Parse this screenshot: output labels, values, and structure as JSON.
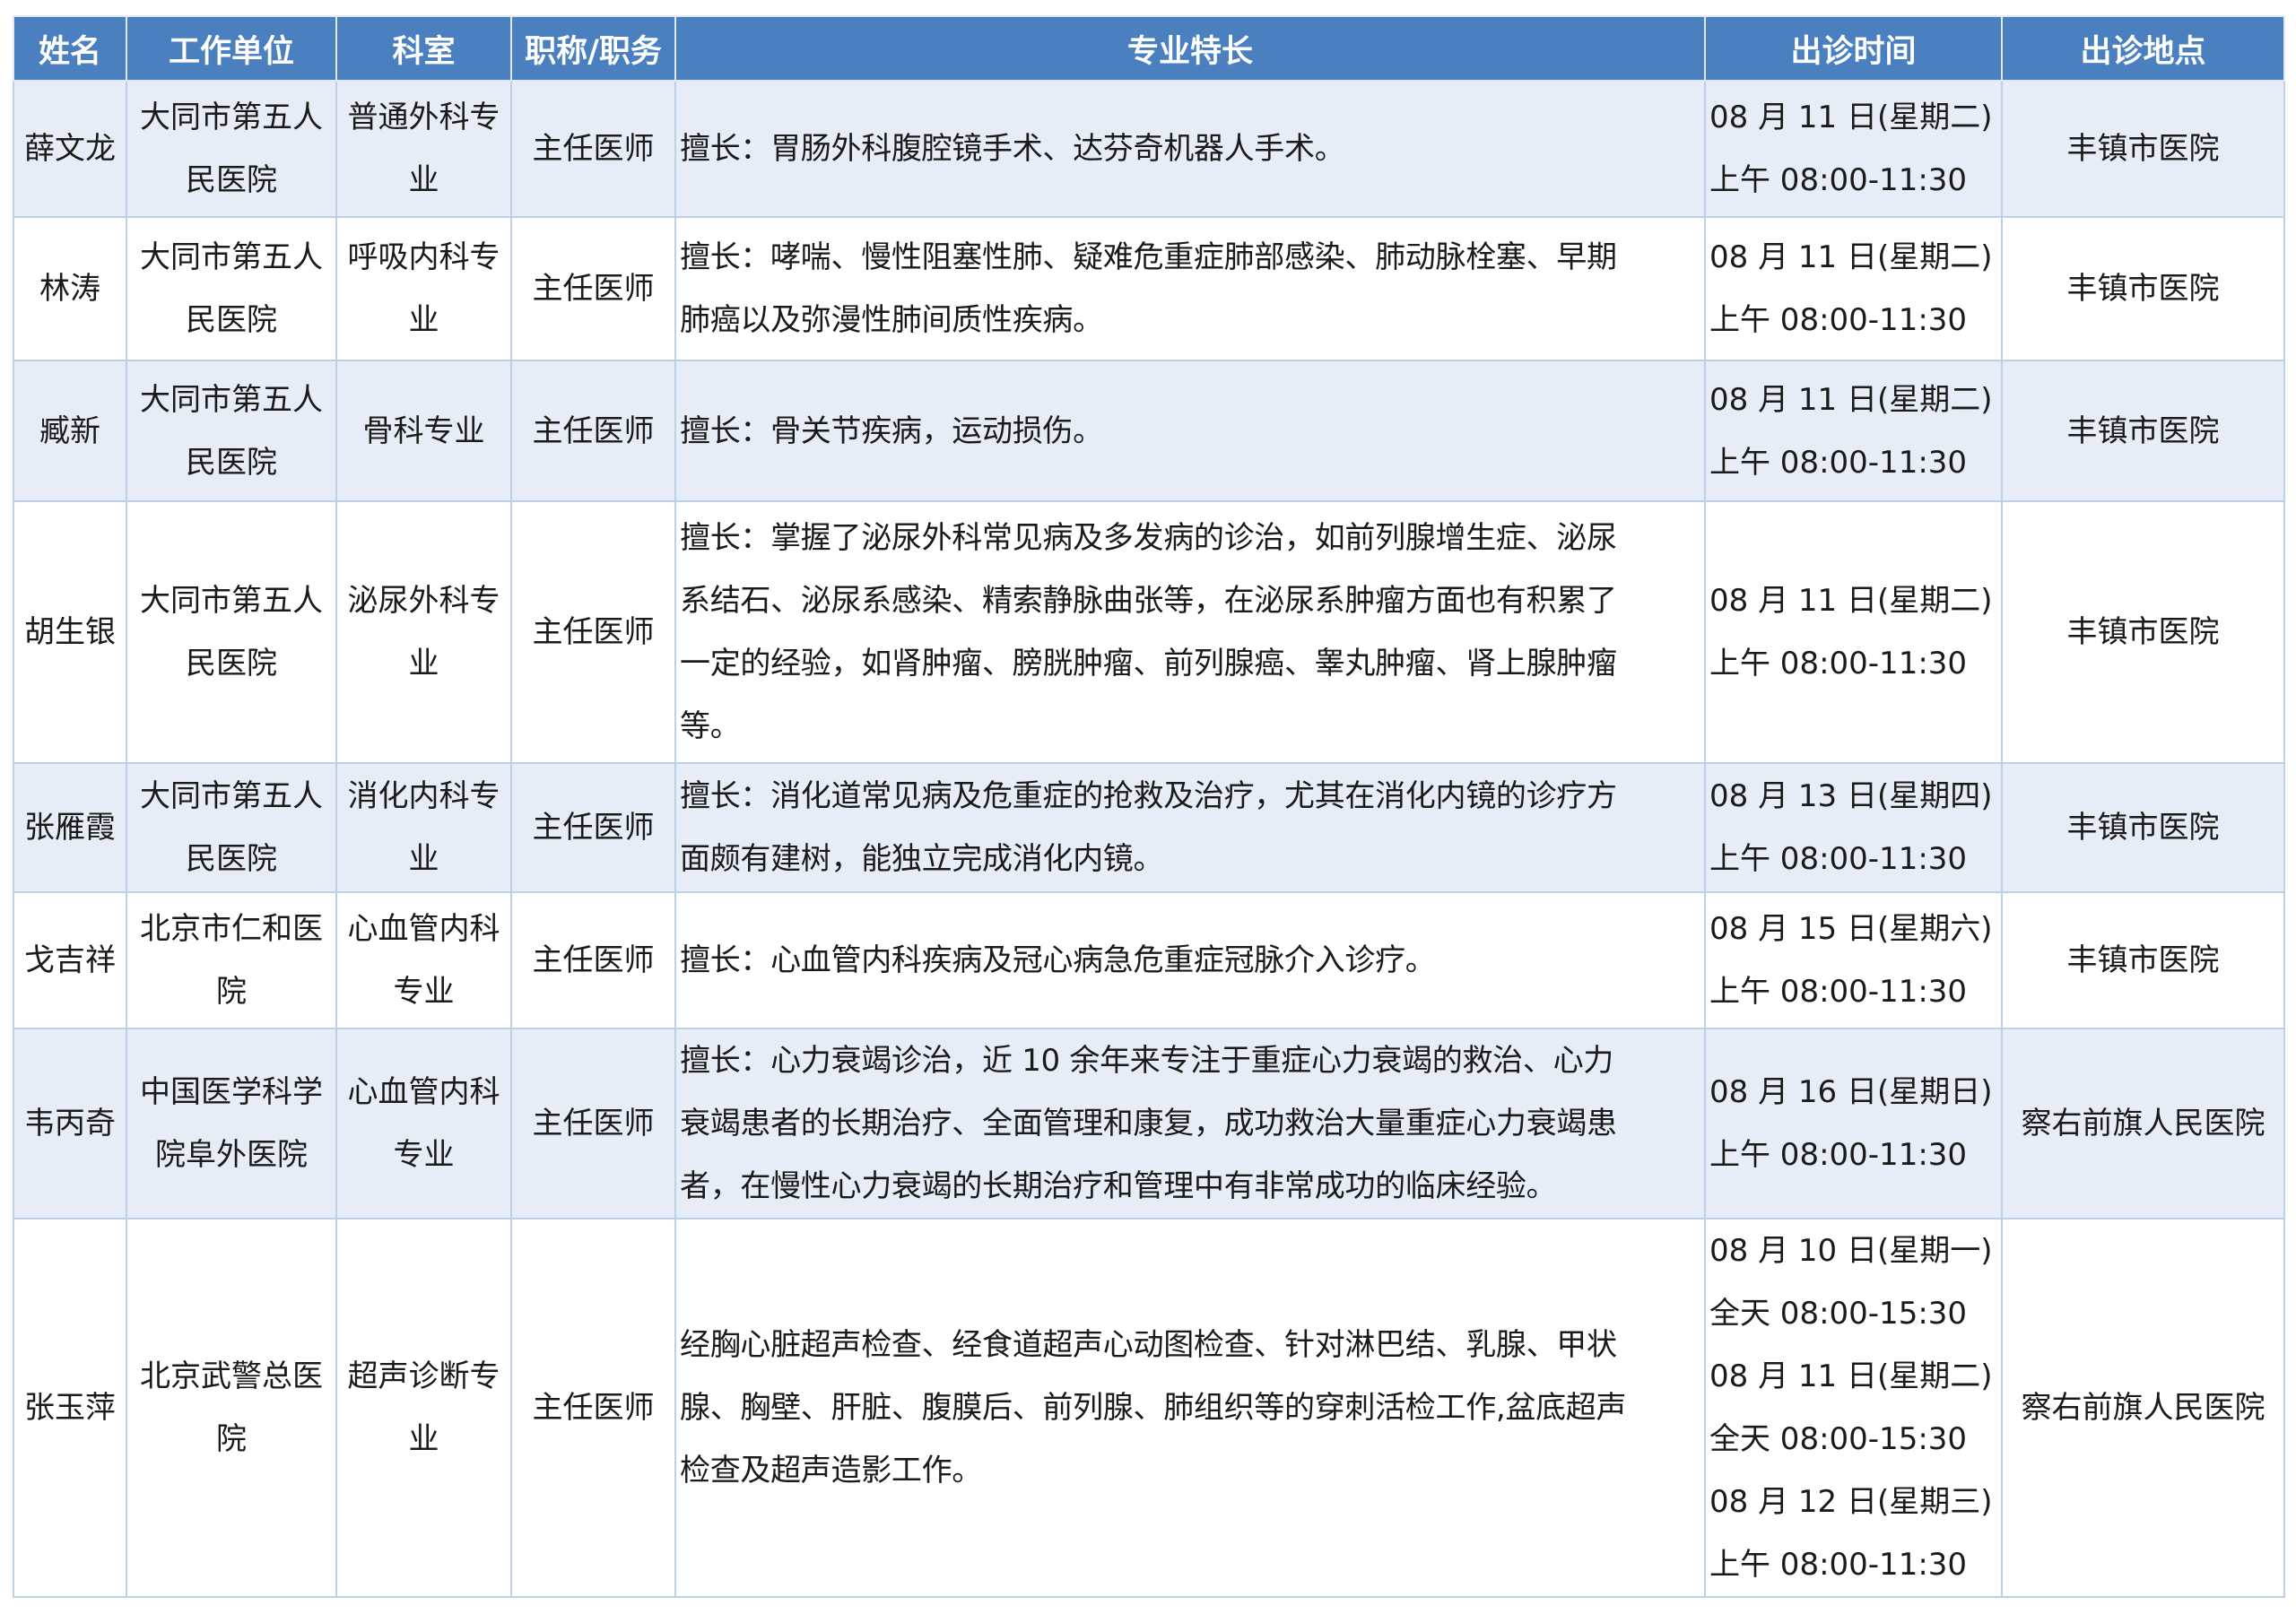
{
  "headers": [
    "姓名",
    "工作单位",
    "科室",
    "职称/职务",
    "专业特长",
    "出诊时间",
    "出诊地点"
  ],
  "rows": [
    {
      "name": "薛文龙",
      "unit": [
        "大同市第五人",
        "民医院"
      ],
      "dept": [
        "普通外科专",
        "业"
      ],
      "title": "主任医师",
      "specialty": [
        "擅长：胃肠外科腹腔镜手术、达芬奇机器人手术。"
      ],
      "times": [
        "08 月 11 日(星期二)",
        "上午 08:00-11:30"
      ],
      "location": "丰镇市医院"
    },
    {
      "name": "林涛",
      "unit": [
        "大同市第五人",
        "民医院"
      ],
      "dept": [
        "呼吸内科专",
        "业"
      ],
      "title": "主任医师",
      "specialty": [
        "擅长：哮喘、慢性阻塞性肺、疑难危重症肺部感染、肺动脉栓塞、早期",
        "肺癌以及弥漫性肺间质性疾病。"
      ],
      "times": [
        "08 月 11 日(星期二)",
        "上午 08:00-11:30"
      ],
      "location": "丰镇市医院"
    },
    {
      "name": "臧新",
      "unit": [
        "大同市第五人",
        "民医院"
      ],
      "dept": [
        "骨科专业"
      ],
      "title": "主任医师",
      "specialty": [
        "擅长：骨关节疾病，运动损伤。"
      ],
      "times": [
        "08 月 11 日(星期二)",
        "上午 08:00-11:30"
      ],
      "location": "丰镇市医院"
    },
    {
      "name": "胡生银",
      "unit": [
        "大同市第五人",
        "民医院"
      ],
      "dept": [
        "泌尿外科专",
        "业"
      ],
      "title": "主任医师",
      "specialty": [
        "擅长：掌握了泌尿外科常见病及多发病的诊治，如前列腺增生症、泌尿",
        "系结石、泌尿系感染、精索静脉曲张等，在泌尿系肿瘤方面也有积累了",
        "一定的经验，如肾肿瘤、膀胱肿瘤、前列腺癌、睾丸肿瘤、肾上腺肿瘤",
        "等。"
      ],
      "times": [
        "08 月 11 日(星期二)",
        "上午 08:00-11:30"
      ],
      "location": "丰镇市医院"
    },
    {
      "name": "张雁霞",
      "unit": [
        "大同市第五人",
        "民医院"
      ],
      "dept": [
        "消化内科专",
        "业"
      ],
      "title": "主任医师",
      "specialty": [
        "擅长：消化道常见病及危重症的抢救及治疗，尤其在消化内镜的诊疗方",
        "面颇有建树，能独立完成消化内镜。"
      ],
      "times": [
        "08 月 13 日(星期四)",
        "上午 08:00-11:30"
      ],
      "location": "丰镇市医院"
    },
    {
      "name": "戈吉祥",
      "unit": [
        "北京市仁和医",
        "院"
      ],
      "dept": [
        "心血管内科",
        "专业"
      ],
      "title": "主任医师",
      "specialty": [
        "擅长：心血管内科疾病及冠心病急危重症冠脉介入诊疗。"
      ],
      "times": [
        "08 月 15 日(星期六)",
        "上午 08:00-11:30"
      ],
      "location": "丰镇市医院"
    },
    {
      "name": "韦丙奇",
      "unit": [
        "中国医学科学",
        "院阜外医院"
      ],
      "dept": [
        "心血管内科",
        "专业"
      ],
      "title": "主任医师",
      "specialty": [
        "擅长：心力衰竭诊治，近 10 余年来专注于重症心力衰竭的救治、心力",
        "衰竭患者的长期治疗、全面管理和康复，成功救治大量重症心力衰竭患",
        "者，在慢性心力衰竭的长期治疗和管理中有非常成功的临床经验。"
      ],
      "times": [
        "08 月 16 日(星期日)",
        "上午 08:00-11:30"
      ],
      "location": "察右前旗人民医院"
    },
    {
      "name": "张玉萍",
      "unit": [
        "北京武警总医",
        "院"
      ],
      "dept": [
        "超声诊断专",
        "业"
      ],
      "title": "主任医师",
      "specialty": [
        "经胸心脏超声检查、经食道超声心动图检查、针对淋巴结、乳腺、甲状",
        "腺、胸壁、肝脏、腹膜后、前列腺、肺组织等的穿刺活检工作,盆底超声",
        "检查及超声造影工作。"
      ],
      "times": [
        "08 月 10 日(星期一)",
        "全天 08:00-15:30",
        "08 月 11 日(星期二)",
        "全天 08:00-15:30",
        "08 月 12 日(星期三)",
        "上午 08:00-11:30"
      ],
      "location": "察右前旗人民医院"
    }
  ],
  "colors": {
    "header_bg": "#4a80c0",
    "band_bg": "#e7edf6",
    "border": "#bed0e6"
  }
}
